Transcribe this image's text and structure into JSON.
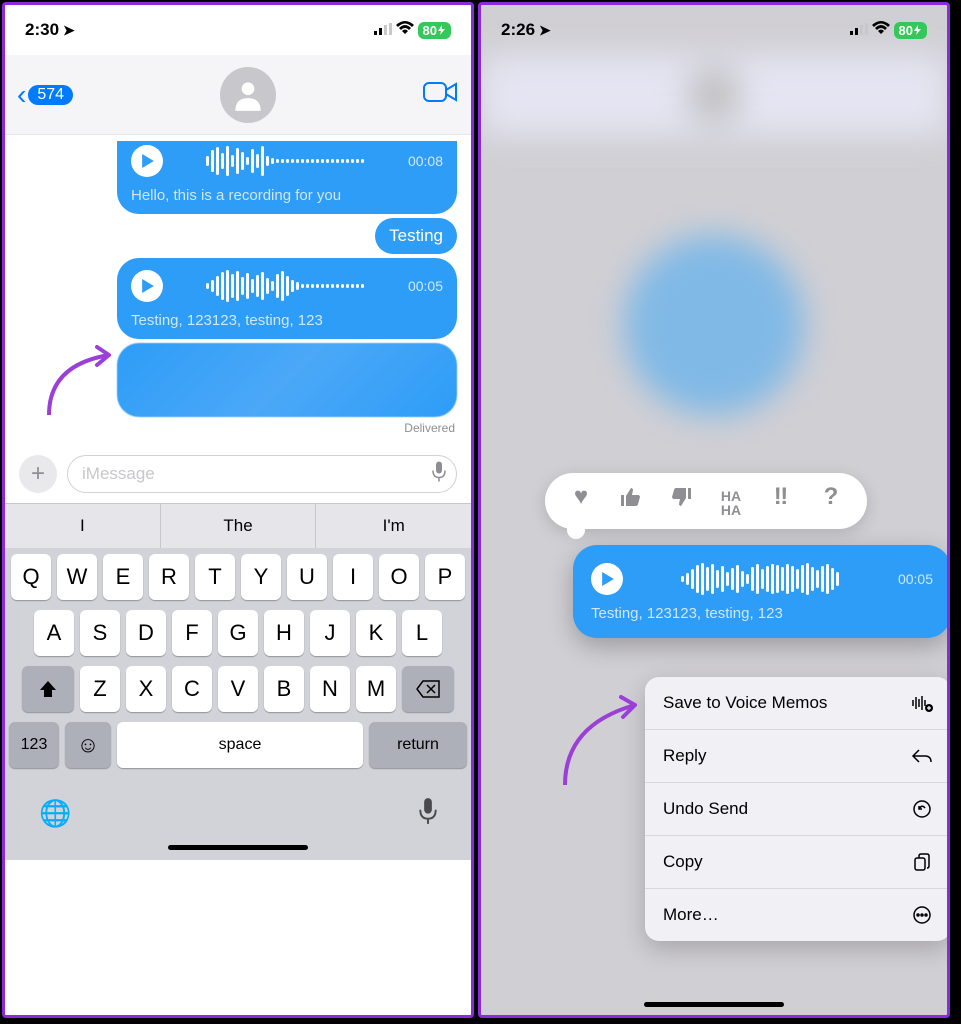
{
  "left": {
    "status": {
      "time": "2:30",
      "battery": "80"
    },
    "header": {
      "back_count": "574"
    },
    "messages": {
      "voice1": {
        "duration": "00:08",
        "caption": "Hello, this is a recording for you"
      },
      "text1": "Testing",
      "voice2": {
        "duration": "00:05",
        "caption": "Testing, 123123, testing, 123"
      },
      "delivered": "Delivered"
    },
    "input": {
      "placeholder": "iMessage"
    },
    "suggestions": [
      "I",
      "The",
      "I'm"
    ],
    "keyboard": {
      "row1": [
        "Q",
        "W",
        "E",
        "R",
        "T",
        "Y",
        "U",
        "I",
        "O",
        "P"
      ],
      "row2": [
        "A",
        "S",
        "D",
        "F",
        "G",
        "H",
        "J",
        "K",
        "L"
      ],
      "row3": [
        "Z",
        "X",
        "C",
        "V",
        "B",
        "N",
        "M"
      ],
      "num": "123",
      "space": "space",
      "return": "return"
    }
  },
  "right": {
    "status": {
      "time": "2:26",
      "battery": "80"
    },
    "focused": {
      "duration": "00:05",
      "caption": "Testing, 123123, testing, 123"
    },
    "tapbacks": [
      "♥",
      "👍",
      "👎",
      "HAHA",
      "‼",
      "?"
    ],
    "menu": [
      {
        "label": "Save to Voice Memos",
        "icon": "waveform-plus"
      },
      {
        "label": "Reply",
        "icon": "reply"
      },
      {
        "label": "Undo Send",
        "icon": "undo"
      },
      {
        "label": "Copy",
        "icon": "copy"
      },
      {
        "label": "More…",
        "icon": "more"
      }
    ]
  }
}
